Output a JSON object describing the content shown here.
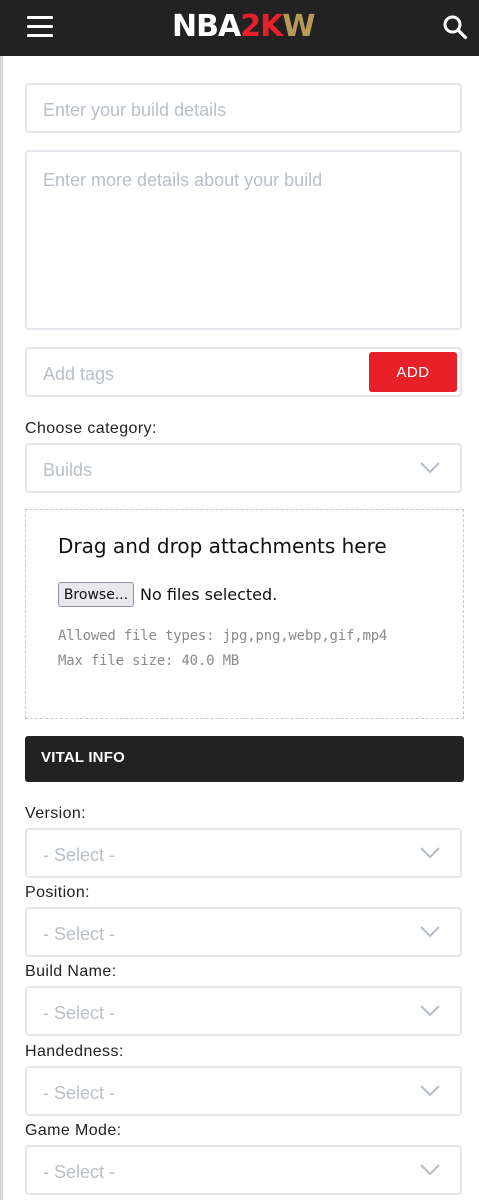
{
  "header": {
    "logo": {
      "part1": "NBA",
      "part2": "2K",
      "part3": "W"
    },
    "colors": {
      "bar": "#222222",
      "red": "#e8202a",
      "gold": "#b79a57"
    }
  },
  "form": {
    "title_placeholder": "Enter your build details",
    "details_placeholder": "Enter more details about your build",
    "tags_placeholder": "Add tags",
    "add_label": "ADD",
    "category_label": "Choose category:",
    "category_value": "Builds"
  },
  "attachments": {
    "title": "Drag and drop attachments here",
    "browse_label": "Browse...",
    "status": "No files selected.",
    "allowed": "Allowed file types: jpg,png,webp,gif,mp4",
    "max_size": "Max file size: 40.0 MB"
  },
  "vital_info": {
    "heading": "VITAL INFO",
    "fields": [
      {
        "label": "Version:",
        "value": "- Select -"
      },
      {
        "label": "Position:",
        "value": "- Select -"
      },
      {
        "label": "Build Name:",
        "value": "- Select -"
      },
      {
        "label": "Handedness:",
        "value": "- Select -"
      },
      {
        "label": "Game Mode:",
        "value": "- Select -"
      }
    ]
  }
}
